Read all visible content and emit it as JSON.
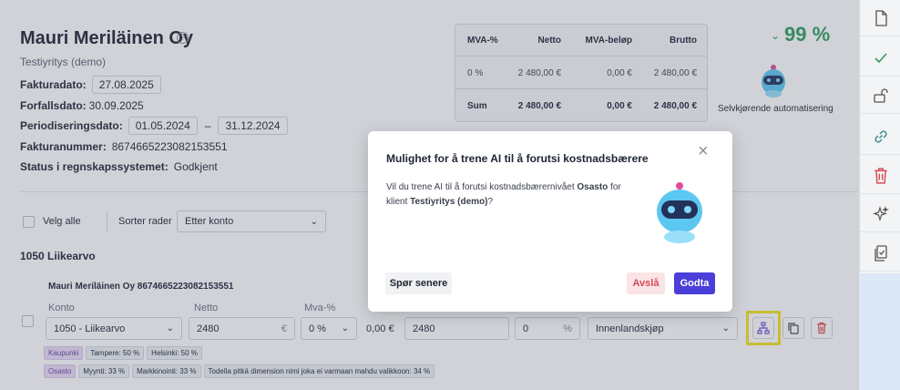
{
  "company": {
    "name": "Mauri Meriläinen Oy",
    "subtitle": "Testiyritys (demo)"
  },
  "fields": {
    "invoice_date_label": "Fakturadato:",
    "invoice_date": "27.08.2025",
    "due_date_label": "Forfallsdato:",
    "due_date": "30.09.2025",
    "period_label": "Periodiseringsdato:",
    "period_start": "01.05.2024",
    "period_sep": "–",
    "period_end": "31.12.2024",
    "invoice_no_label": "Fakturanummer:",
    "invoice_no": "8674665223082153551",
    "status_label": "Status i regnskapssystemet:",
    "status": "Godkjent"
  },
  "vat_table": {
    "headers": [
      "MVA-%",
      "Netto",
      "MVA-beløp",
      "Brutto"
    ],
    "rows": [
      [
        "0 %",
        "2 480,00 €",
        "0,00 €",
        "2 480,00 €"
      ]
    ],
    "sum": [
      "Sum",
      "2 480,00 €",
      "0,00 €",
      "2 480,00 €"
    ]
  },
  "automation": {
    "percent": "99 %",
    "label": "Selvkjørende automatisering"
  },
  "toolbar": {
    "select_all": "Velg alle",
    "sort_label": "Sorter rader",
    "sort_value": "Etter konto"
  },
  "account_group": "1050 Liikearvo",
  "line": {
    "header": "Mauri Meriläinen Oy 8674665223082153551",
    "col_account": "Konto",
    "col_net": "Netto",
    "col_vat": "Mva-%",
    "account": "1050 - Liikearvo",
    "net": "2480",
    "currency": "€",
    "vat": "0 %",
    "vat_amount": "0,00 €",
    "gross": "2480",
    "percent_field": "0",
    "percent_unit": "%",
    "vat_type": "Innenlandskjøp",
    "tags_row1": [
      {
        "text": "Kaupunki",
        "primary": true
      },
      {
        "text": "Tampere: 50 %"
      },
      {
        "text": "Helsinki: 50 %"
      }
    ],
    "tags_row2": [
      {
        "text": "Osasto",
        "primary": true
      },
      {
        "text": "Myynti: 33 %"
      },
      {
        "text": "Markkinointi: 33 %"
      },
      {
        "text": "Todella pitkä dimension nimi joka ei varmaan mahdu valikkoon: 34 %"
      }
    ]
  },
  "modal": {
    "title": "Mulighet for å trene AI til å forutsi kostnadsbærere",
    "body_pre": "Vil du trene AI til å forutsi kostnadsbærernivået ",
    "body_bold1": "Osasto",
    "body_mid": " for klient ",
    "body_bold2": "Testiyritys (demo)",
    "body_post": "?",
    "later": "Spør senere",
    "decline": "Avslå",
    "accept": "Godta"
  },
  "colors": {
    "accent": "#4a3fd8",
    "success": "#2e9d5b",
    "danger": "#d84a55",
    "highlight": "#f2e21c"
  }
}
